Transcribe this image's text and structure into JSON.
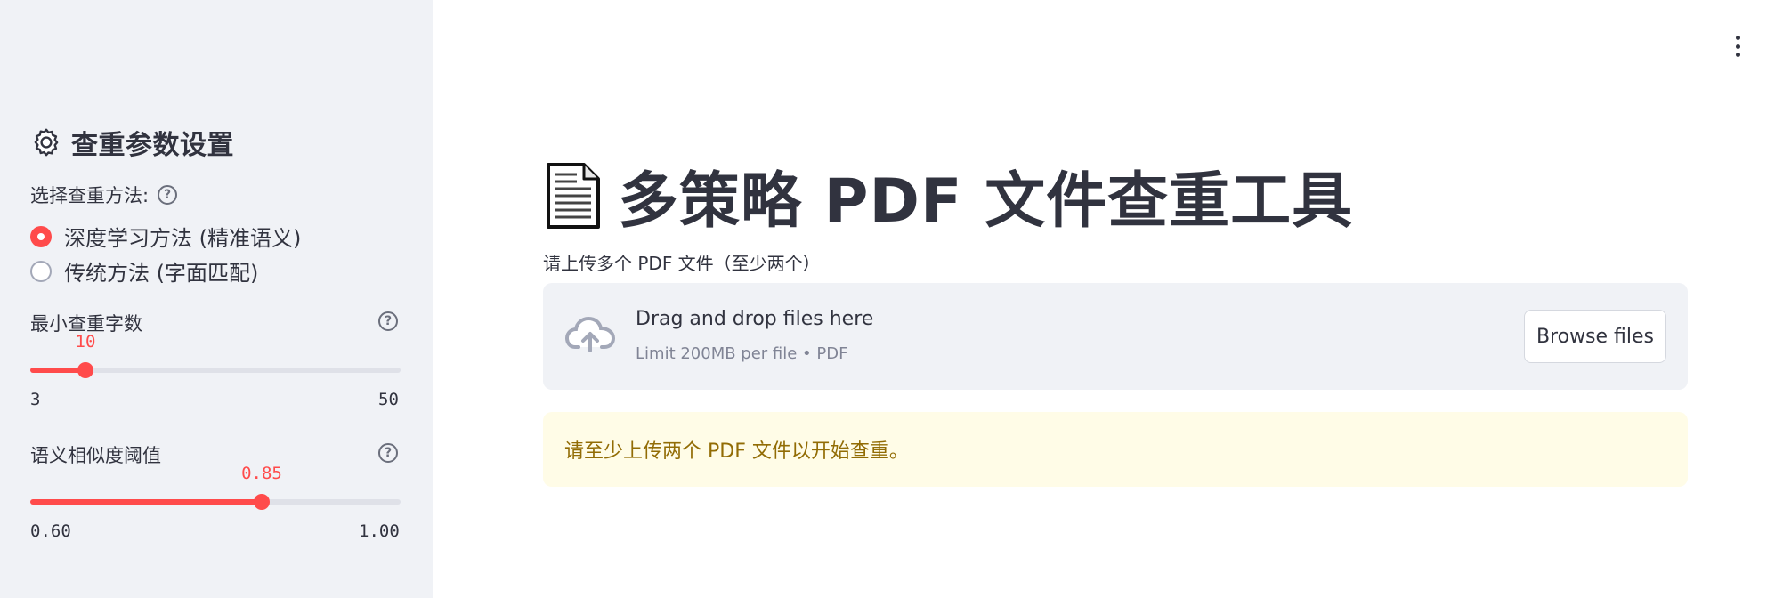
{
  "sidebar": {
    "title": "查重参数设置",
    "method_label": "选择查重方法:",
    "methods": [
      {
        "label": "深度学习方法 (精准语义)",
        "selected": true
      },
      {
        "label": "传统方法 (字面匹配)",
        "selected": false
      }
    ],
    "min_chars": {
      "label": "最小查重字数",
      "value": "10",
      "min": "3",
      "max": "50",
      "fraction": 0.149
    },
    "similarity": {
      "label": "语义相似度阈值",
      "value": "0.85",
      "min": "0.60",
      "max": "1.00",
      "fraction": 0.625
    }
  },
  "main": {
    "title": "多策略 PDF 文件查重工具",
    "upload_label": "请上传多个 PDF 文件（至少两个）",
    "dropzone": {
      "primary": "Drag and drop files here",
      "secondary": "Limit 200MB per file • PDF",
      "browse_label": "Browse files"
    },
    "warning": "请至少上传两个 PDF 文件以开始查重。"
  },
  "colors": {
    "accent": "#ff4b4b",
    "sidebar_bg": "#f0f2f6",
    "warning_bg": "#fffce7",
    "warning_text": "#926c05"
  },
  "icons": [
    "gear-icon",
    "help-icon",
    "document-icon",
    "cloud-upload-icon",
    "more-vertical-icon"
  ]
}
